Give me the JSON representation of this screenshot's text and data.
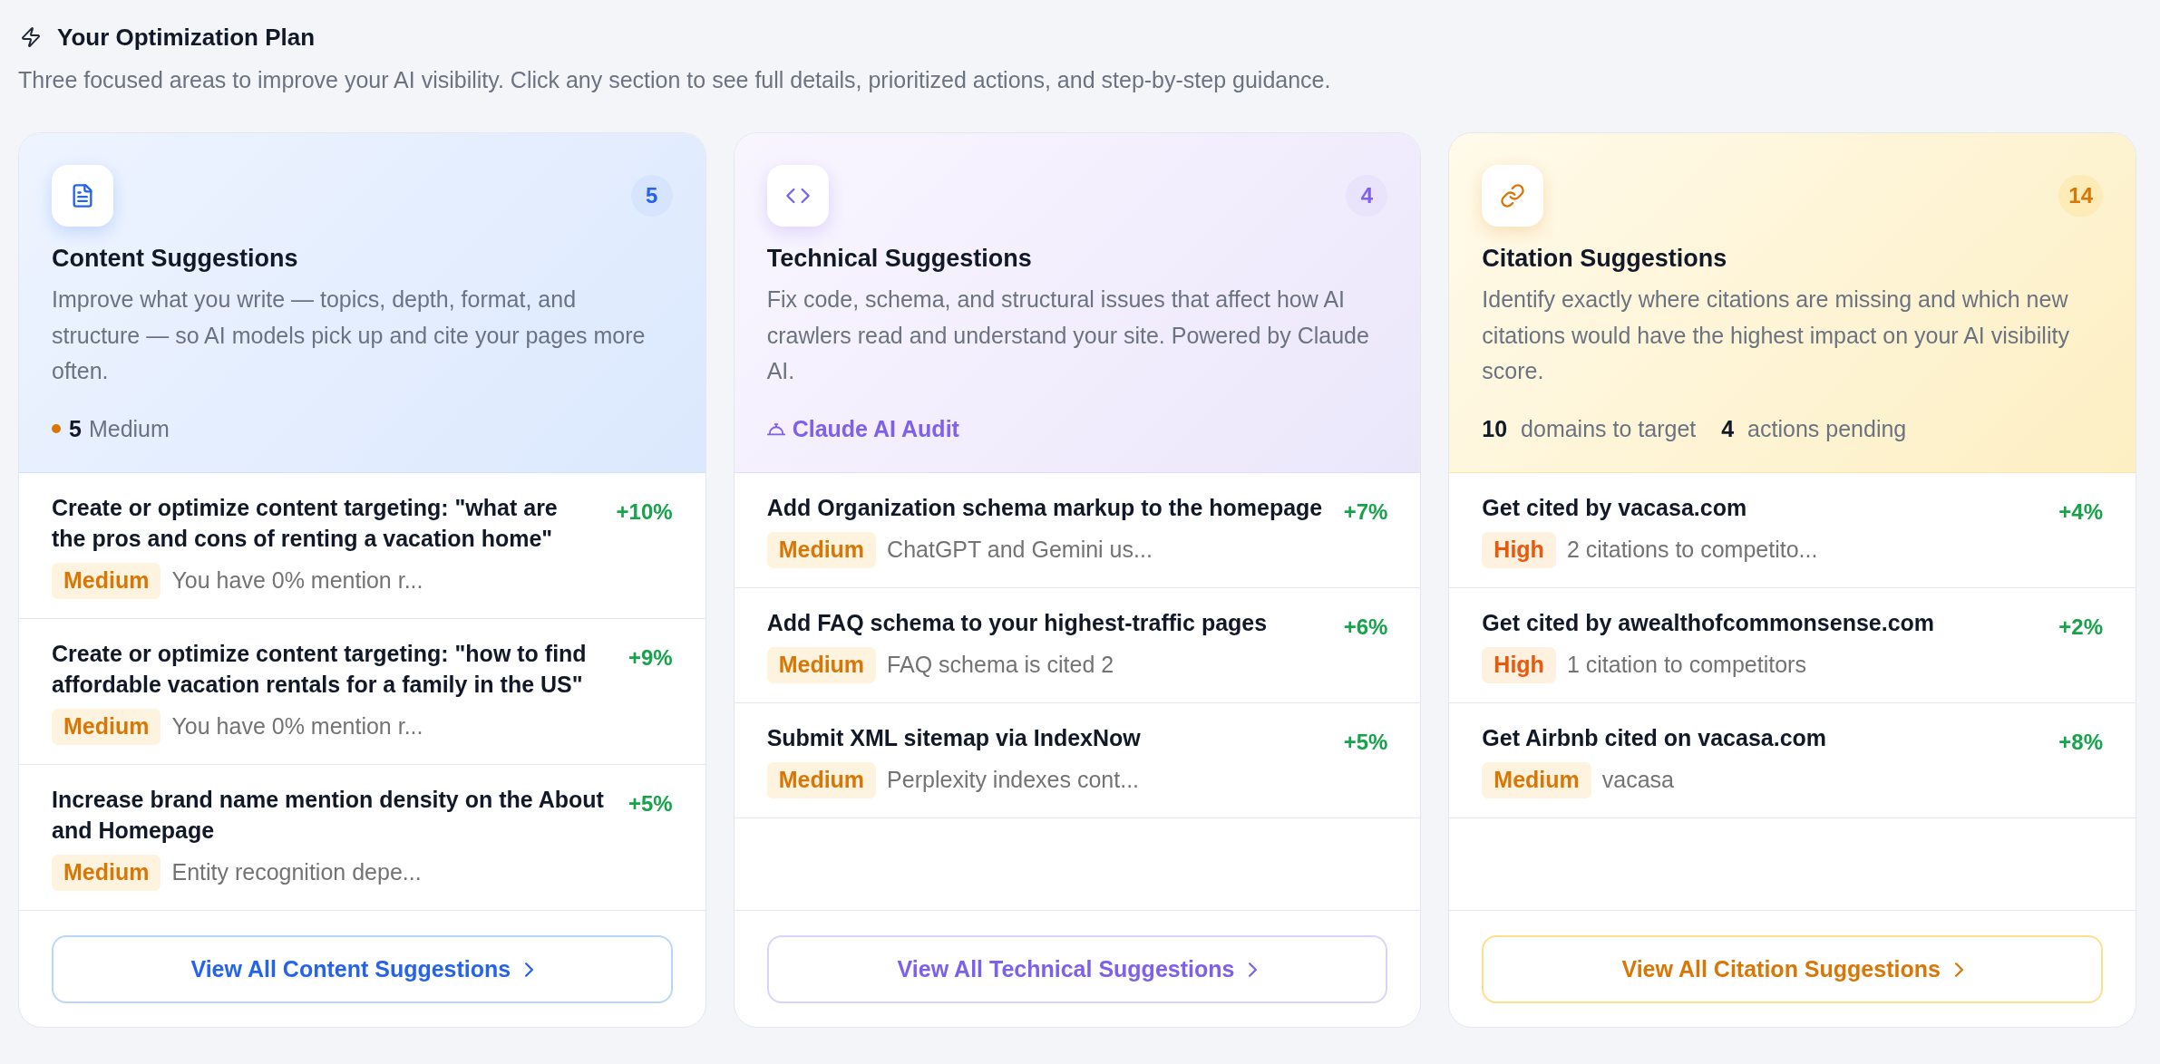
{
  "header": {
    "title": "Your Optimization Plan",
    "subtitle": "Three focused areas to improve your AI visibility. Click any section to see full details, prioritized actions, and step-by-step guidance."
  },
  "sections": [
    {
      "kind": "content",
      "count": "5",
      "title": "Content Suggestions",
      "description": "Improve what you write — topics, depth, format, and structure — so AI models pick up and cite your pages more often.",
      "summary": {
        "kind": "priority",
        "color": "#d97706",
        "count": "5",
        "label": "Medium"
      },
      "items": [
        {
          "title": "Create or optimize content targeting: \"what are the pros and cons of renting a vacation home\"",
          "badge": "Medium",
          "color": "#d97706",
          "note": "You have 0% mention r...",
          "impact": "+10%"
        },
        {
          "title": "Create or optimize content targeting: \"how to find affordable vacation rentals for a family in the US\"",
          "badge": "Medium",
          "color": "#d97706",
          "note": "You have 0% mention r...",
          "impact": "+9%"
        },
        {
          "title": "Increase brand name mention density on the About and Homepage",
          "badge": "Medium",
          "color": "#d97706",
          "note": "Entity recognition depe...",
          "impact": "+5%"
        }
      ],
      "button": "View All Content Suggestions"
    },
    {
      "kind": "technical",
      "count": "4",
      "title": "Technical Suggestions",
      "description": "Fix code, schema, and structural issues that affect how AI crawlers read and understand your site. Powered by Claude AI.",
      "summary": {
        "kind": "audit",
        "label": "Claude AI Audit"
      },
      "items": [
        {
          "title": "Add Organization schema markup to the homepage",
          "badge": "Medium",
          "color": "#d97706",
          "note": "ChatGPT and Gemini us...",
          "impact": "+7%"
        },
        {
          "title": "Add FAQ schema to your highest-traffic pages",
          "badge": "Medium",
          "color": "#d97706",
          "note": "FAQ schema is cited 2",
          "impact": "+6%"
        },
        {
          "title": "Submit XML sitemap via IndexNow",
          "badge": "Medium",
          "color": "#d97706",
          "note": "Perplexity indexes cont...",
          "impact": "+5%"
        }
      ],
      "button": "View All Technical Suggestions"
    },
    {
      "kind": "citation",
      "count": "14",
      "title": "Citation Suggestions",
      "description": "Identify exactly where citations are missing and which new citations would have the highest impact on your AI visibility score.",
      "summary": {
        "kind": "stats",
        "stats": [
          "**10** domains to target",
          "**4** actions pending"
        ]
      },
      "items": [
        {
          "title": "Get cited by vacasa.com",
          "badge": "High",
          "color": "#ea580c",
          "note": "2 citations to competito...",
          "impact": "+4%"
        },
        {
          "title": "Get cited by awealthofcommonsense.com",
          "badge": "High",
          "color": "#ea580c",
          "note": "1 citation to competitors",
          "impact": "+2%"
        },
        {
          "title": "Get Airbnb cited on vacasa.com",
          "badge": "Medium",
          "color": "#d97706",
          "note": "vacasa",
          "impact": "+8%"
        }
      ],
      "button": "View All Citation Suggestions"
    }
  ]
}
